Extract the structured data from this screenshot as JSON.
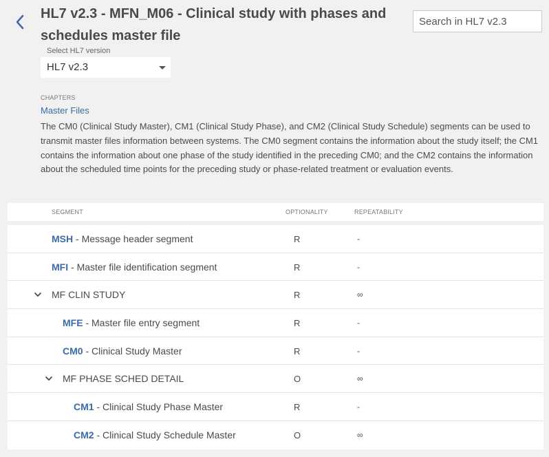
{
  "header": {
    "title": "HL7 v2.3 - MFN_M06 - Clinical study with phases and schedules master file",
    "search_placeholder": "Search in HL7 v2.3"
  },
  "version": {
    "label": "Select HL7 version",
    "selected": "HL7 v2.3"
  },
  "chapters": {
    "label": "CHAPTERS",
    "link": "Master Files",
    "description": "The CM0 (Clinical Study Master), CM1 (Clinical Study Phase), and CM2 (Clinical Study Schedule) segments can be used to transmit master files information between systems. The CM0 segment contains the information about the study itself; the CM1 contains the information about one phase of the study identified in the preceding CM0; and the CM2 contains the information about the scheduled time points for the preceding study or phase-related treatment or evaluation events."
  },
  "table": {
    "headers": {
      "segment": "SEGMENT",
      "optionality": "OPTIONALITY",
      "repeatability": "REPEATABILITY"
    },
    "rows": [
      {
        "code": "MSH",
        "sep": " - ",
        "name": "Message header segment",
        "optionality": "R",
        "repeatability": "-"
      },
      {
        "code": "MFI",
        "sep": " - ",
        "name": "Master file identification segment",
        "optionality": "R",
        "repeatability": "-"
      },
      {
        "group": "MF CLIN STUDY",
        "optionality": "R",
        "repeatability": "∞"
      },
      {
        "code": "MFE",
        "sep": " - ",
        "name": "Master file entry segment",
        "optionality": "R",
        "repeatability": "-"
      },
      {
        "code": "CM0",
        "sep": " - ",
        "name": "Clinical Study Master",
        "optionality": "R",
        "repeatability": "-"
      },
      {
        "group": "MF PHASE SCHED DETAIL",
        "optionality": "O",
        "repeatability": "∞"
      },
      {
        "code": "CM1",
        "sep": " - ",
        "name": "Clinical Study Phase Master",
        "optionality": "R",
        "repeatability": "-"
      },
      {
        "code": "CM2",
        "sep": " - ",
        "name": "Clinical Study Schedule Master",
        "optionality": "O",
        "repeatability": "∞"
      }
    ]
  },
  "icons": {
    "back": "chevron-left-icon",
    "expand": "chevron-down-icon",
    "dropdown": "caret-down-icon"
  },
  "colors": {
    "link": "#3c6aa8",
    "background": "#f1f1f1"
  }
}
